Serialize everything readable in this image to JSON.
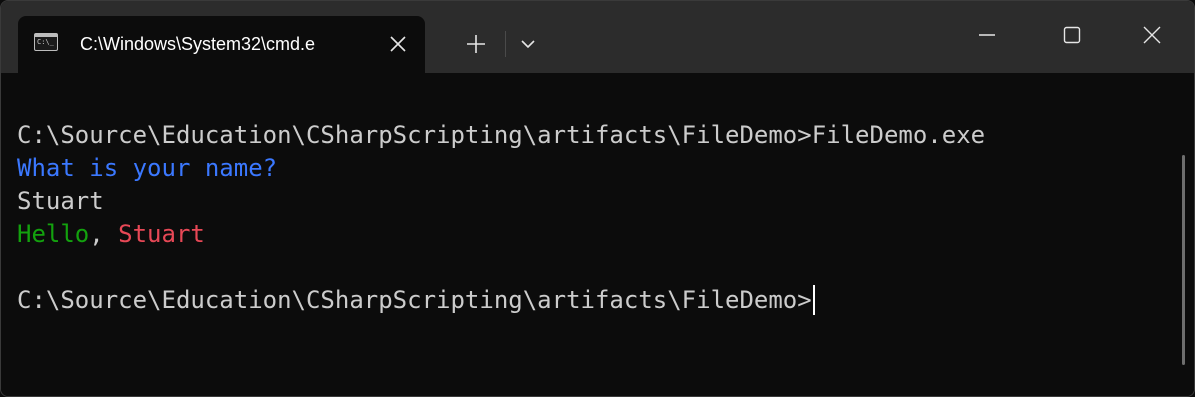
{
  "window": {
    "tab_title": "C:\\Windows\\System32\\cmd.e",
    "tab_icon": "command-prompt-icon",
    "tab_icon_glyph": "C:\\_",
    "buttons": {
      "tab_close": "close-icon",
      "new_tab": "plus-icon",
      "dropdown": "chevron-down-icon",
      "minimize": "minimize-icon",
      "maximize": "maximize-icon",
      "close": "close-icon"
    }
  },
  "terminal": {
    "line1": "C:\\Source\\Education\\CSharpScripting\\artifacts\\FileDemo>FileDemo.exe",
    "line2": "What is your name?",
    "line3": "Stuart",
    "line4": {
      "greeting": "Hello",
      "separator": ", ",
      "name": "Stuart"
    },
    "prompt": "C:\\Source\\Education\\CSharpScripting\\artifacts\\FileDemo>"
  },
  "colors": {
    "background": "#0c0c0c",
    "titlebar": "#2c2c2c",
    "text": "#cccccc",
    "blue": "#3b78ff",
    "green": "#13a10e",
    "red": "#e74856"
  }
}
